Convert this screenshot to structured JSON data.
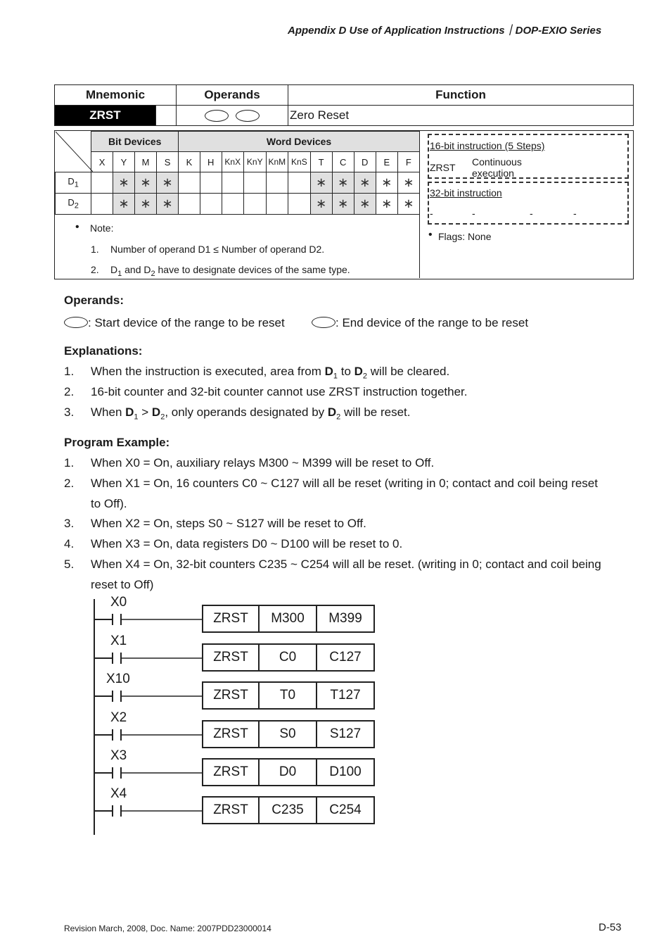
{
  "header": {
    "title": "Appendix D Use of Application Instructions｜DOP-EXIO Series"
  },
  "summary_table": {
    "headers": {
      "mnemonic": "Mnemonic",
      "operands": "Operands",
      "function": "Function"
    },
    "mnemonic": "ZRST",
    "operand_symbols": [
      "D1-oval",
      "D2-oval"
    ],
    "function": "Zero Reset"
  },
  "device_table": {
    "group_headers": {
      "bit": "Bit Devices",
      "word": "Word Devices"
    },
    "columns": [
      "X",
      "Y",
      "M",
      "S",
      "K",
      "H",
      "KnX",
      "KnY",
      "KnM",
      "KnS",
      "T",
      "C",
      "D",
      "E",
      "F"
    ],
    "shaded_columns": [
      "Y",
      "M",
      "S",
      "T",
      "C",
      "D"
    ],
    "rows": [
      {
        "label": "D",
        "sub": "1",
        "cells": [
          "",
          "*",
          "*",
          "*",
          "",
          "",
          "",
          "",
          "",
          "",
          "*",
          "*",
          "*",
          "*",
          "*"
        ]
      },
      {
        "label": "D",
        "sub": "2",
        "cells": [
          "",
          "*",
          "*",
          "*",
          "",
          "",
          "",
          "",
          "",
          "",
          "*",
          "*",
          "*",
          "*",
          "*"
        ]
      }
    ],
    "star_glyph": "∗",
    "note_label": "Note:",
    "notes": [
      {
        "num": "1.",
        "text": "Number of operand D1 ≤ Number of operand D2."
      },
      {
        "num": "2.",
        "pre": "D",
        "s1": "1",
        "mid": " and D",
        "s2": "2",
        "post": " have to designate devices of the same type."
      }
    ]
  },
  "instruction_info": {
    "bit16": {
      "title": "16-bit instruction (5 Steps)",
      "mnemonic": "ZRST",
      "mode_line1": "Continuous",
      "mode_line2": "execution"
    },
    "bit32": {
      "title": "32-bit instruction",
      "values": [
        "-",
        "-",
        "-",
        "-"
      ]
    },
    "flags": "Flags: None"
  },
  "operands_section": {
    "title": "Operands:",
    "d1": ": Start device of the range to be reset",
    "d2": ": End device of the range to be reset"
  },
  "explanations": {
    "title": "Explanations:",
    "items": [
      {
        "num": "1.",
        "a": "When the instruction is executed, area from ",
        "b": "D",
        "b_sub": "1",
        "c": " to ",
        "d": "D",
        "d_sub": "2",
        "e": " will be cleared."
      },
      {
        "num": "2.",
        "text": "16-bit counter and 32-bit counter cannot use ZRST instruction together."
      },
      {
        "num": "3.",
        "a": "When ",
        "b": "D",
        "b_sub": "1",
        "c": " > ",
        "d": "D",
        "d_sub": "2",
        "e": ", only operands designated by ",
        "f": "D",
        "f_sub": "2",
        "g": " will be reset."
      }
    ]
  },
  "program_example": {
    "title": "Program Example:",
    "items": [
      {
        "num": "1.",
        "lines": [
          "When X0 = On, auxiliary relays M300 ~ M399 will be reset to Off."
        ]
      },
      {
        "num": "2.",
        "lines": [
          "When X1 = On, 16 counters C0 ~ C127 will all be reset (writing in 0; contact and coil being reset",
          "to Off)."
        ]
      },
      {
        "num": "3.",
        "lines": [
          "When X2 = On, steps S0 ~ S127 will be reset to Off."
        ]
      },
      {
        "num": "4.",
        "lines": [
          "When X3 = On, data registers D0 ~ D100 will be reset to 0."
        ]
      },
      {
        "num": "5.",
        "lines": [
          "When X4 = On, 32-bit counters C235 ~ C254 will all be reset. (writing in 0; contact and coil being",
          "reset to Off)"
        ]
      }
    ]
  },
  "ladder": {
    "rungs": [
      {
        "contact": "X0",
        "instr": "ZRST",
        "op1": "M300",
        "op2": "M399"
      },
      {
        "contact": "X1",
        "instr": "ZRST",
        "op1": "C0",
        "op2": "C127"
      },
      {
        "contact": "X10",
        "instr": "ZRST",
        "op1": "T0",
        "op2": "T127"
      },
      {
        "contact": "X2",
        "instr": "ZRST",
        "op1": "S0",
        "op2": "S127"
      },
      {
        "contact": "X3",
        "instr": "ZRST",
        "op1": "D0",
        "op2": "D100"
      },
      {
        "contact": "X4",
        "instr": "ZRST",
        "op1": "C235",
        "op2": "C254"
      }
    ]
  },
  "footer": {
    "revision": "Revision March, 2008, Doc. Name: 2007PDD23000014",
    "page": "D-53"
  }
}
